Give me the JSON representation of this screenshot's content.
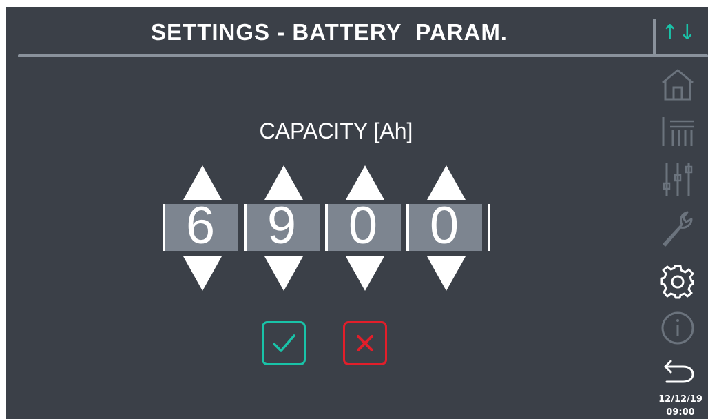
{
  "header": {
    "title": "SETTINGS - BATTERY  PARAM.",
    "sort_icon": "up-down-arrows-icon",
    "sort_glyph": "↑↓"
  },
  "editor": {
    "field_label": "CAPACITY [Ah]",
    "digits": [
      "6",
      "9",
      "0",
      "0"
    ],
    "confirm_icon": "check-icon",
    "cancel_icon": "x-icon"
  },
  "sidebar": {
    "items": [
      {
        "icon": "home-icon",
        "active": false
      },
      {
        "icon": "measurements-icon",
        "active": false
      },
      {
        "icon": "sliders-icon",
        "active": false
      },
      {
        "icon": "wrench-icon",
        "active": false
      },
      {
        "icon": "gear-icon",
        "active": true
      },
      {
        "icon": "info-icon",
        "active": false
      },
      {
        "icon": "back-icon",
        "active": false
      }
    ]
  },
  "status": {
    "date": "12/12/19",
    "time": "09:00"
  },
  "colors": {
    "background": "#3b4048",
    "digit_box": "#7d8590",
    "accent_teal": "#19c3a8",
    "cancel_red": "#e21e2a",
    "inactive_icon": "#6b737d"
  }
}
